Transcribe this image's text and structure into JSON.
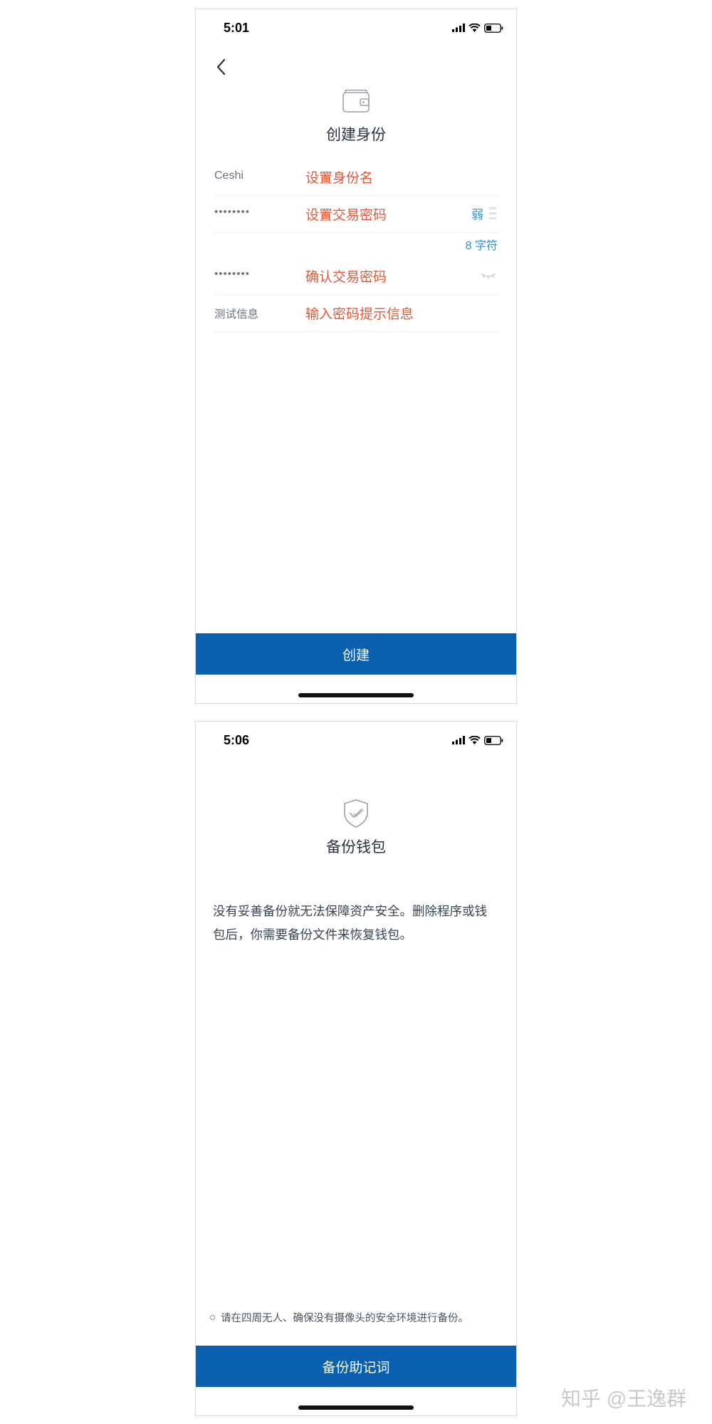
{
  "screen_create": {
    "status_time": "5:01",
    "title": "创建身份",
    "rows": [
      {
        "value": "Ceshi",
        "placeholder": "设置身份名"
      },
      {
        "value": "••••••••",
        "placeholder": "设置交易密码",
        "strength": "弱"
      },
      {
        "value": "••••••••",
        "placeholder": "确认交易密码"
      },
      {
        "value": "测试信息",
        "placeholder": "输入密码提示信息"
      }
    ],
    "char_count": "8 字符",
    "create_button": "创建"
  },
  "screen_backup": {
    "status_time": "5:06",
    "title": "备份钱包",
    "description": "没有妥善备份就无法保障资产安全。删除程序或钱包后，你需要备份文件来恢复钱包。",
    "tip": "请在四周无人、确保没有摄像头的安全环境进行备份。",
    "backup_button": "备份助记词"
  },
  "watermark": "知乎 @王逸群",
  "colors": {
    "accent_blue": "#0b60b0",
    "placeholder_red": "#e05a3a",
    "info_blue": "#2f8fd9"
  },
  "icons": {
    "back": "chevron-left-icon",
    "wallet": "wallet-icon",
    "shield": "shield-check-icon",
    "eye": "eye-closed-icon",
    "signal": "signal-icon",
    "wifi": "wifi-icon",
    "battery": "battery-icon"
  }
}
